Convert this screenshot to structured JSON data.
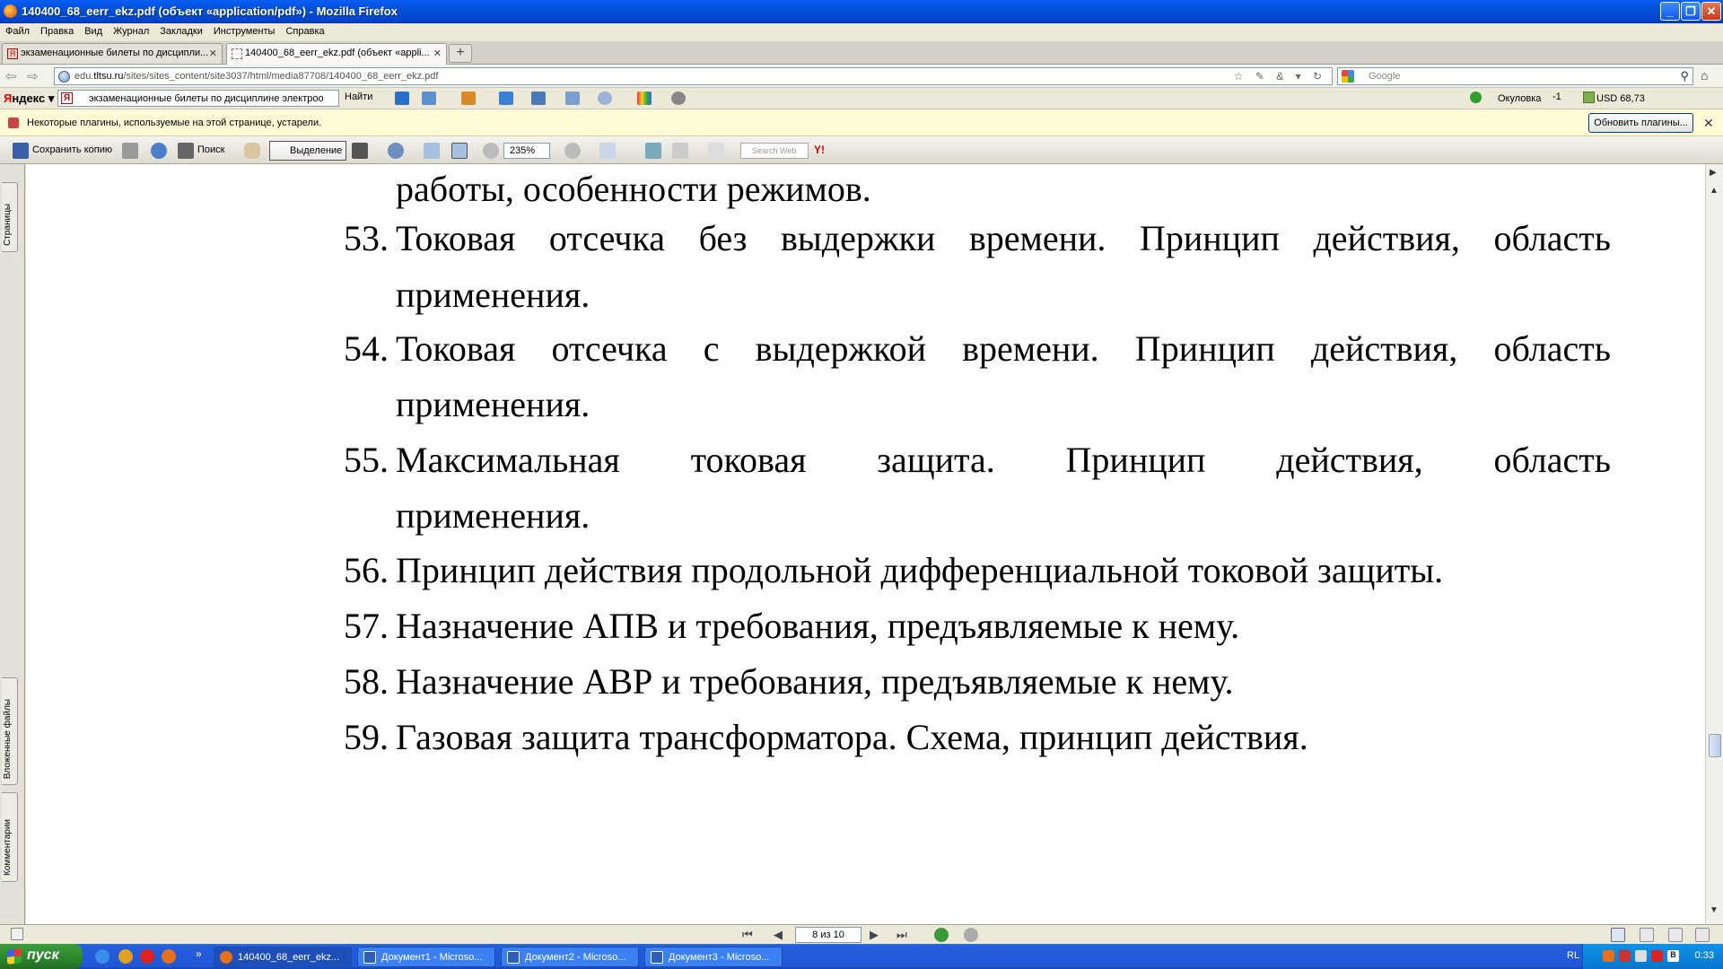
{
  "window": {
    "title": "140400_68_eerr_ekz.pdf (объект «application/pdf») - Mozilla Firefox",
    "minimize": "_",
    "restore": "❐",
    "close": "✕"
  },
  "menu": [
    "Файл",
    "Правка",
    "Вид",
    "Журнал",
    "Закладки",
    "Инструменты",
    "Справка"
  ],
  "tabs": [
    {
      "label": "экзаменационные билеты по дисципли...",
      "close": "✕"
    },
    {
      "label": "140400_68_eerr_ekz.pdf (объект «appli...",
      "close": "✕"
    }
  ],
  "new_tab": "+",
  "nav": {
    "back": "⇦",
    "forward": "⇨",
    "url_prefix": "edu.",
    "url_domain": "tltsu.ru",
    "url_path": "/sites/sites_content/site3037/html/media87708/140400_68_eerr_ekz.pdf",
    "search_placeholder": "Google",
    "home": "⌂",
    "url_icons": "☆ ✎ & ▾ ↻",
    "search_glyph": "⚲"
  },
  "yandex": {
    "logo_r": "Я",
    "logo_rest": "ндекс",
    "query": "экзаменационные билеты по дисциплине электроо",
    "find": "Найти",
    "ya_badge": "Я",
    "city": "Окуловка",
    "temp": "-1",
    "usd": "USD 68,73"
  },
  "plugin": {
    "message": "Некоторые плагины, используемые на этой странице, устарели.",
    "update_button": "Обновить плагины...",
    "close": "✕"
  },
  "pdf_toolbar": {
    "save_copy": "Сохранить копию",
    "search": "Поиск",
    "select": "Выделение",
    "zoom": "235%",
    "search_web": "Search Web",
    "yahoo": "Y!"
  },
  "side_tabs": {
    "pages": "Страницы",
    "attachments": "Вложенные файлы",
    "comments": "Комментарии"
  },
  "document": {
    "top_continuation": "работы, особенности режимов.",
    "questions": [
      {
        "num": "53.",
        "line1": "Токовая отсечка без выдержки времени. Принцип действия, область",
        "line2": "применения."
      },
      {
        "num": "54.",
        "line1": "Токовая отсечка с выдержкой времени. Принцип действия, область",
        "line2": "применения."
      },
      {
        "num": "55.",
        "line1": "Максимальная токовая защита. Принцип действия, область",
        "line2": "применения."
      },
      {
        "num": "56.",
        "line1": "Принцип действия продольной дифференциальной токовой защиты."
      },
      {
        "num": "57.",
        "line1": "Назначение АПВ и требования, предъявляемые к нему."
      },
      {
        "num": "58.",
        "line1": "Назначение АВР и требования, предъявляемые к нему."
      },
      {
        "num": "59.",
        "line1": "Газовая защита трансформатора. Схема, принцип действия."
      }
    ]
  },
  "pager": {
    "page_text": "8 из 10",
    "first": "⏮",
    "prev": "◀",
    "next": "▶",
    "last": "⏭"
  },
  "taskbar": {
    "start": "пуск",
    "tasks": [
      "140400_68_eerr_ekz...",
      "Документ1 - Microso...",
      "Документ2 - Microso...",
      "Документ3 - Microso..."
    ],
    "lang": "RL",
    "clock": "0:33",
    "overflow": "»"
  }
}
